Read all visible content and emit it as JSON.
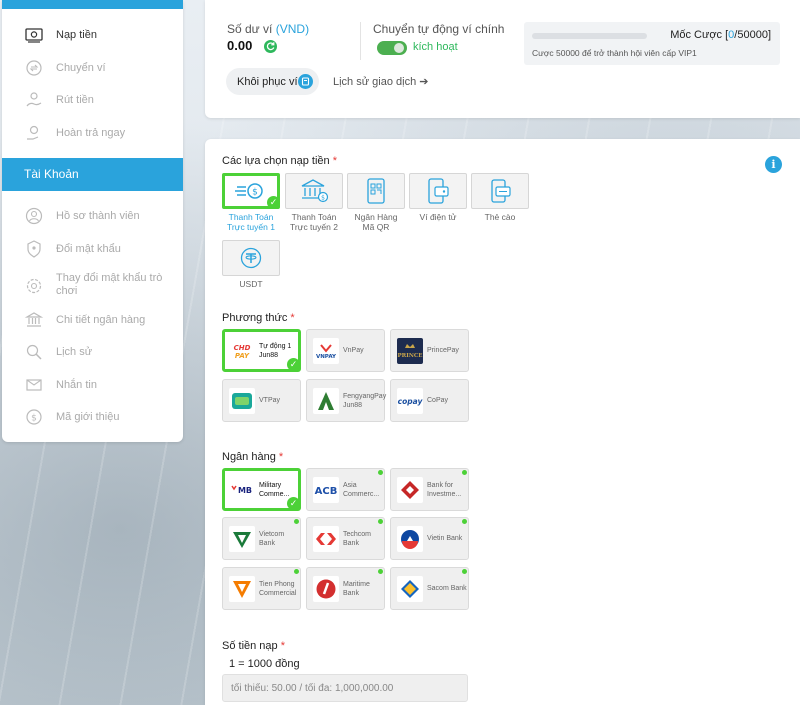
{
  "sidebar": {
    "items_top": [
      {
        "label": "Nạp tiền",
        "icon": "deposit-money-icon",
        "active": true
      },
      {
        "label": "Chuyển ví",
        "icon": "transfer-wallet-icon",
        "active": false
      },
      {
        "label": "Rút tiền",
        "icon": "withdraw-icon",
        "active": false
      },
      {
        "label": "Hoàn trả ngay",
        "icon": "rebate-icon",
        "active": false
      }
    ],
    "section_header": "Tài Khoản",
    "items_account": [
      {
        "label": "Hồ sơ thành viên",
        "icon": "profile-icon"
      },
      {
        "label": "Đổi mật khẩu",
        "icon": "password-icon"
      },
      {
        "label": "Thay đổi mật khẩu trò chơi",
        "icon": "game-password-icon"
      },
      {
        "label": "Chi tiết ngân hàng",
        "icon": "bank-icon"
      },
      {
        "label": "Lịch sử",
        "icon": "history-icon"
      },
      {
        "label": "Nhắn tin",
        "icon": "mail-icon"
      },
      {
        "label": "Mã giới thiệu",
        "icon": "referral-icon"
      }
    ]
  },
  "wallet": {
    "balance_label": "Số dư ví ",
    "balance_unit": "(VND)",
    "balance_value": "0.00",
    "auto_transfer_label": "Chuyển tự động ví chính",
    "auto_transfer_state": "kích hoạt",
    "restore_button": "Khôi phục ví",
    "history_link": "Lịch sử giao dịch ➔",
    "milestone_title_prefix": "Mốc Cược [",
    "milestone_current": "0",
    "milestone_target": "/50000]",
    "milestone_progress": 0,
    "milestone_note": "Cược 50000 để trở thành hội viên cấp VIP1"
  },
  "deposit_options": {
    "title": "Các lựa chọn nạp tiền ",
    "required_mark": "*",
    "options": [
      {
        "label_line1": "Thanh Toán",
        "label_line2": "Trực tuyến 1",
        "icon": "online-payment-icon",
        "selected": true
      },
      {
        "label_line1": "Thanh Toán",
        "label_line2": "Trực tuyến 2",
        "icon": "bank-building-icon",
        "selected": false
      },
      {
        "label_line1": "Ngân Hàng",
        "label_line2": "Mã QR",
        "icon": "qr-code-icon",
        "selected": false
      },
      {
        "label_line1": "Ví điện tử",
        "label_line2": "",
        "icon": "e-wallet-icon",
        "selected": false
      },
      {
        "label_line1": "Thẻ cào",
        "label_line2": "",
        "icon": "scratch-card-icon",
        "selected": false
      },
      {
        "label_line1": "USDT",
        "label_line2": "",
        "icon": "usdt-icon",
        "selected": false
      }
    ]
  },
  "methods": {
    "title": "Phương thức ",
    "required_mark": "*",
    "items": [
      {
        "logo_text": "CHDPAY",
        "name": "Tự động 1 Jun88",
        "selected": true
      },
      {
        "logo_text": "VNPAY",
        "name": "VnPay",
        "selected": false
      },
      {
        "logo_text": "PRINCE",
        "name": "PrincePay",
        "selected": false
      },
      {
        "logo_text": "VT",
        "name": "VTPay",
        "selected": false
      },
      {
        "logo_text": "F",
        "name": "FengyangPay Jun88",
        "selected": false
      },
      {
        "logo_text": "copay",
        "name": "CoPay",
        "selected": false
      }
    ]
  },
  "banks": {
    "title": "Ngân hàng ",
    "required_mark": "*",
    "items": [
      {
        "logo_text": "MB",
        "name": "Military Comme...",
        "selected": true
      },
      {
        "logo_text": "ACB",
        "name": "Asia Commerc...",
        "selected": false
      },
      {
        "logo_text": "BIDV",
        "name": "Bank for Investme...",
        "selected": false
      },
      {
        "logo_text": "VCB",
        "name": "Vietcom Bank",
        "selected": false
      },
      {
        "logo_text": "TCB",
        "name": "Techcom Bank",
        "selected": false
      },
      {
        "logo_text": "VTB",
        "name": "Vietin Bank",
        "selected": false
      },
      {
        "logo_text": "TPB",
        "name": "Tien Phong Commercial",
        "selected": false
      },
      {
        "logo_text": "MSB",
        "name": "Maritime Bank",
        "selected": false
      },
      {
        "logo_text": "STB",
        "name": "Sacom Bank",
        "selected": false
      }
    ]
  },
  "amount": {
    "title": "Số tiền nạp ",
    "required_mark": "*",
    "rate_note": "1 = 1000 đồng",
    "placeholder": "tối thiểu: 50.00 / tối đa: 1,000,000.00"
  },
  "colors": {
    "accent": "#2aa3dc",
    "selected_border": "#4cd137",
    "required": "#e53935"
  }
}
